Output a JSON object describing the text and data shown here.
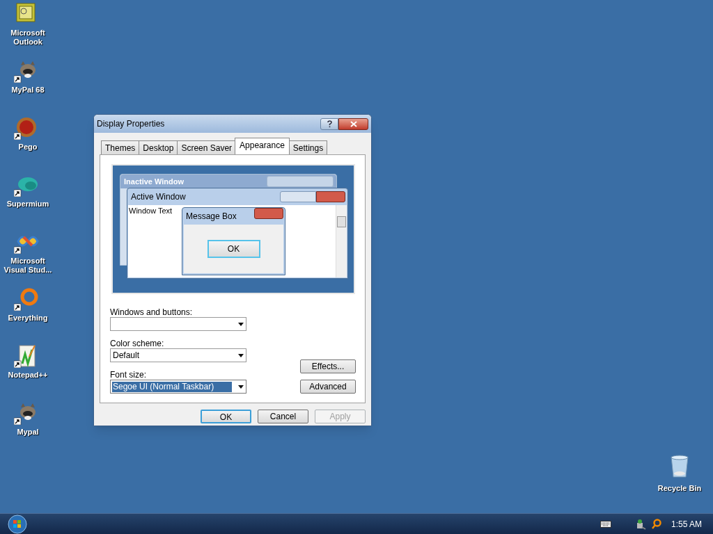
{
  "desktop_icons": [
    {
      "label": "Microsoft Outlook",
      "kind": "outlook",
      "shortcut": false
    },
    {
      "label": "MyPal 68",
      "kind": "raccoon",
      "shortcut": true
    },
    {
      "label": "Pego",
      "kind": "ball",
      "shortcut": true
    },
    {
      "label": "Supermium",
      "kind": "cloud",
      "shortcut": true
    },
    {
      "label": "Microsoft Visual Stud...",
      "kind": "infinity",
      "shortcut": true
    },
    {
      "label": "Everything",
      "kind": "ring",
      "shortcut": true
    },
    {
      "label": "Notepad++",
      "kind": "notepad",
      "shortcut": true
    },
    {
      "label": "Mypal",
      "kind": "raccoon",
      "shortcut": true
    }
  ],
  "recycle_bin": {
    "label": "Recycle Bin"
  },
  "dialog": {
    "title": "Display Properties",
    "tabs": [
      {
        "label": "Themes",
        "selected": false
      },
      {
        "label": "Desktop",
        "selected": false
      },
      {
        "label": "Screen Saver",
        "selected": false
      },
      {
        "label": "Appearance",
        "selected": true
      },
      {
        "label": "Settings",
        "selected": false
      }
    ],
    "preview": {
      "inactive_window_title": "Inactive Window",
      "active_window_title": "Active Window",
      "window_text": "Window Text",
      "message_box_title": "Message Box",
      "message_box_button": "OK"
    },
    "fields": [
      {
        "label": "Windows and buttons:",
        "highlighted": false
      },
      {
        "label": "Color scheme:",
        "value": "Default",
        "highlighted": false
      },
      {
        "label": "Font size:",
        "value": "Segoe UI (Normal Taskbar)",
        "highlighted": true
      }
    ],
    "side_buttons": [
      "Effects...",
      "Advanced"
    ],
    "buttons": [
      {
        "label": "OK",
        "default": true,
        "disabled": false
      },
      {
        "label": "Cancel",
        "default": false,
        "disabled": false
      },
      {
        "label": "Apply",
        "default": false,
        "disabled": true
      }
    ]
  },
  "taskbar": {
    "clock": "1:55 AM"
  }
}
